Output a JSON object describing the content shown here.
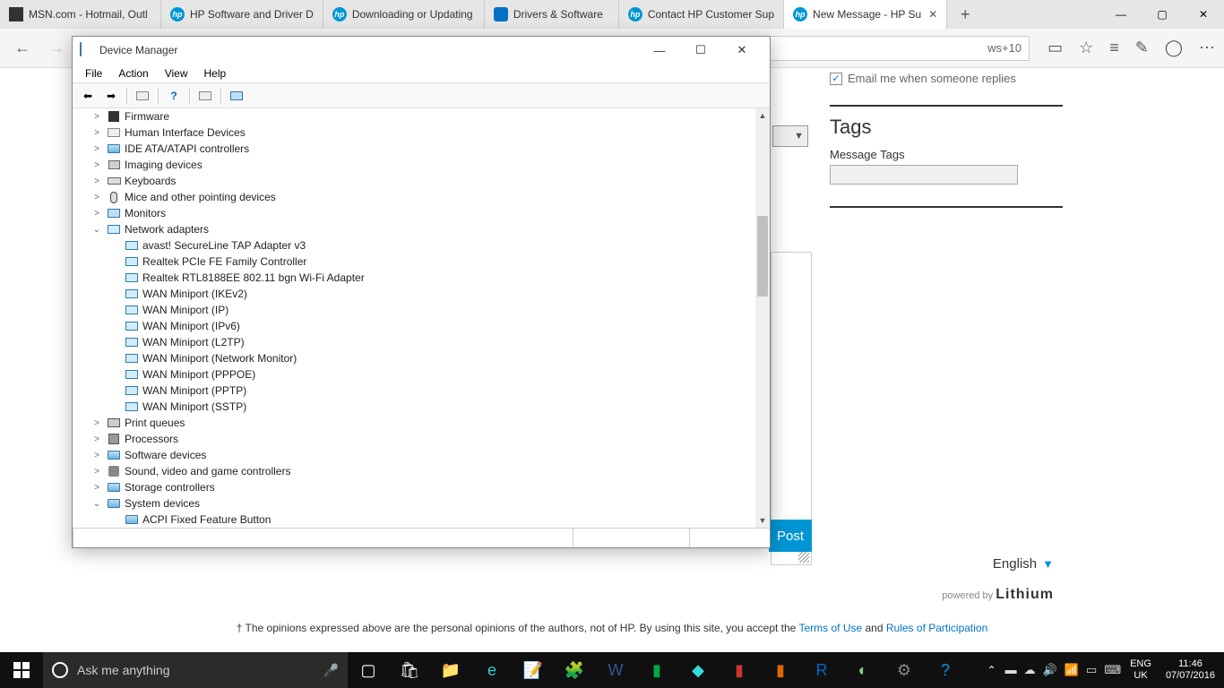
{
  "browser": {
    "tabs": [
      {
        "title": "MSN.com - Hotmail, Outl"
      },
      {
        "title": "HP Software and Driver D"
      },
      {
        "title": "Downloading or Updating"
      },
      {
        "title": "Drivers & Software"
      },
      {
        "title": "Contact HP Customer Sup"
      },
      {
        "title": "New Message - HP Su"
      }
    ],
    "url": "ws+10"
  },
  "page": {
    "email_me": "Email me when someone replies",
    "tags_heading": "Tags",
    "tags_label": "Message Tags",
    "post_btn": "Post",
    "language": "English",
    "powered_by": "powered by",
    "lithium": "Lithium",
    "disclaimer_pre": "† The opinions expressed above are the personal opinions of the authors, not of HP. By using this site, you accept the ",
    "terms": "Terms of Use",
    "and": " and ",
    "rules": "Rules of Participation"
  },
  "dm": {
    "title": "Device Manager",
    "menu": {
      "file": "File",
      "action": "Action",
      "view": "View",
      "help": "Help"
    },
    "tree": {
      "collapsed": [
        "Firmware",
        "Human Interface Devices",
        "IDE ATA/ATAPI controllers",
        "Imaging devices",
        "Keyboards",
        "Mice and other pointing devices",
        "Monitors"
      ],
      "net_label": "Network adapters",
      "net_children": [
        "avast! SecureLine TAP Adapter v3",
        "Realtek PCIe FE Family Controller",
        "Realtek RTL8188EE 802.11 bgn Wi-Fi Adapter",
        "WAN Miniport (IKEv2)",
        "WAN Miniport (IP)",
        "WAN Miniport (IPv6)",
        "WAN Miniport (L2TP)",
        "WAN Miniport (Network Monitor)",
        "WAN Miniport (PPPOE)",
        "WAN Miniport (PPTP)",
        "WAN Miniport (SSTP)"
      ],
      "collapsed2": [
        "Print queues",
        "Processors",
        "Software devices",
        "Sound, video and game controllers",
        "Storage controllers"
      ],
      "sys_label": "System devices",
      "sys_child": "ACPI Fixed Feature Button"
    }
  },
  "taskbar": {
    "cortana": "Ask me anything",
    "lang1": "ENG",
    "lang2": "UK",
    "time": "11:46",
    "date": "07/07/2016"
  }
}
